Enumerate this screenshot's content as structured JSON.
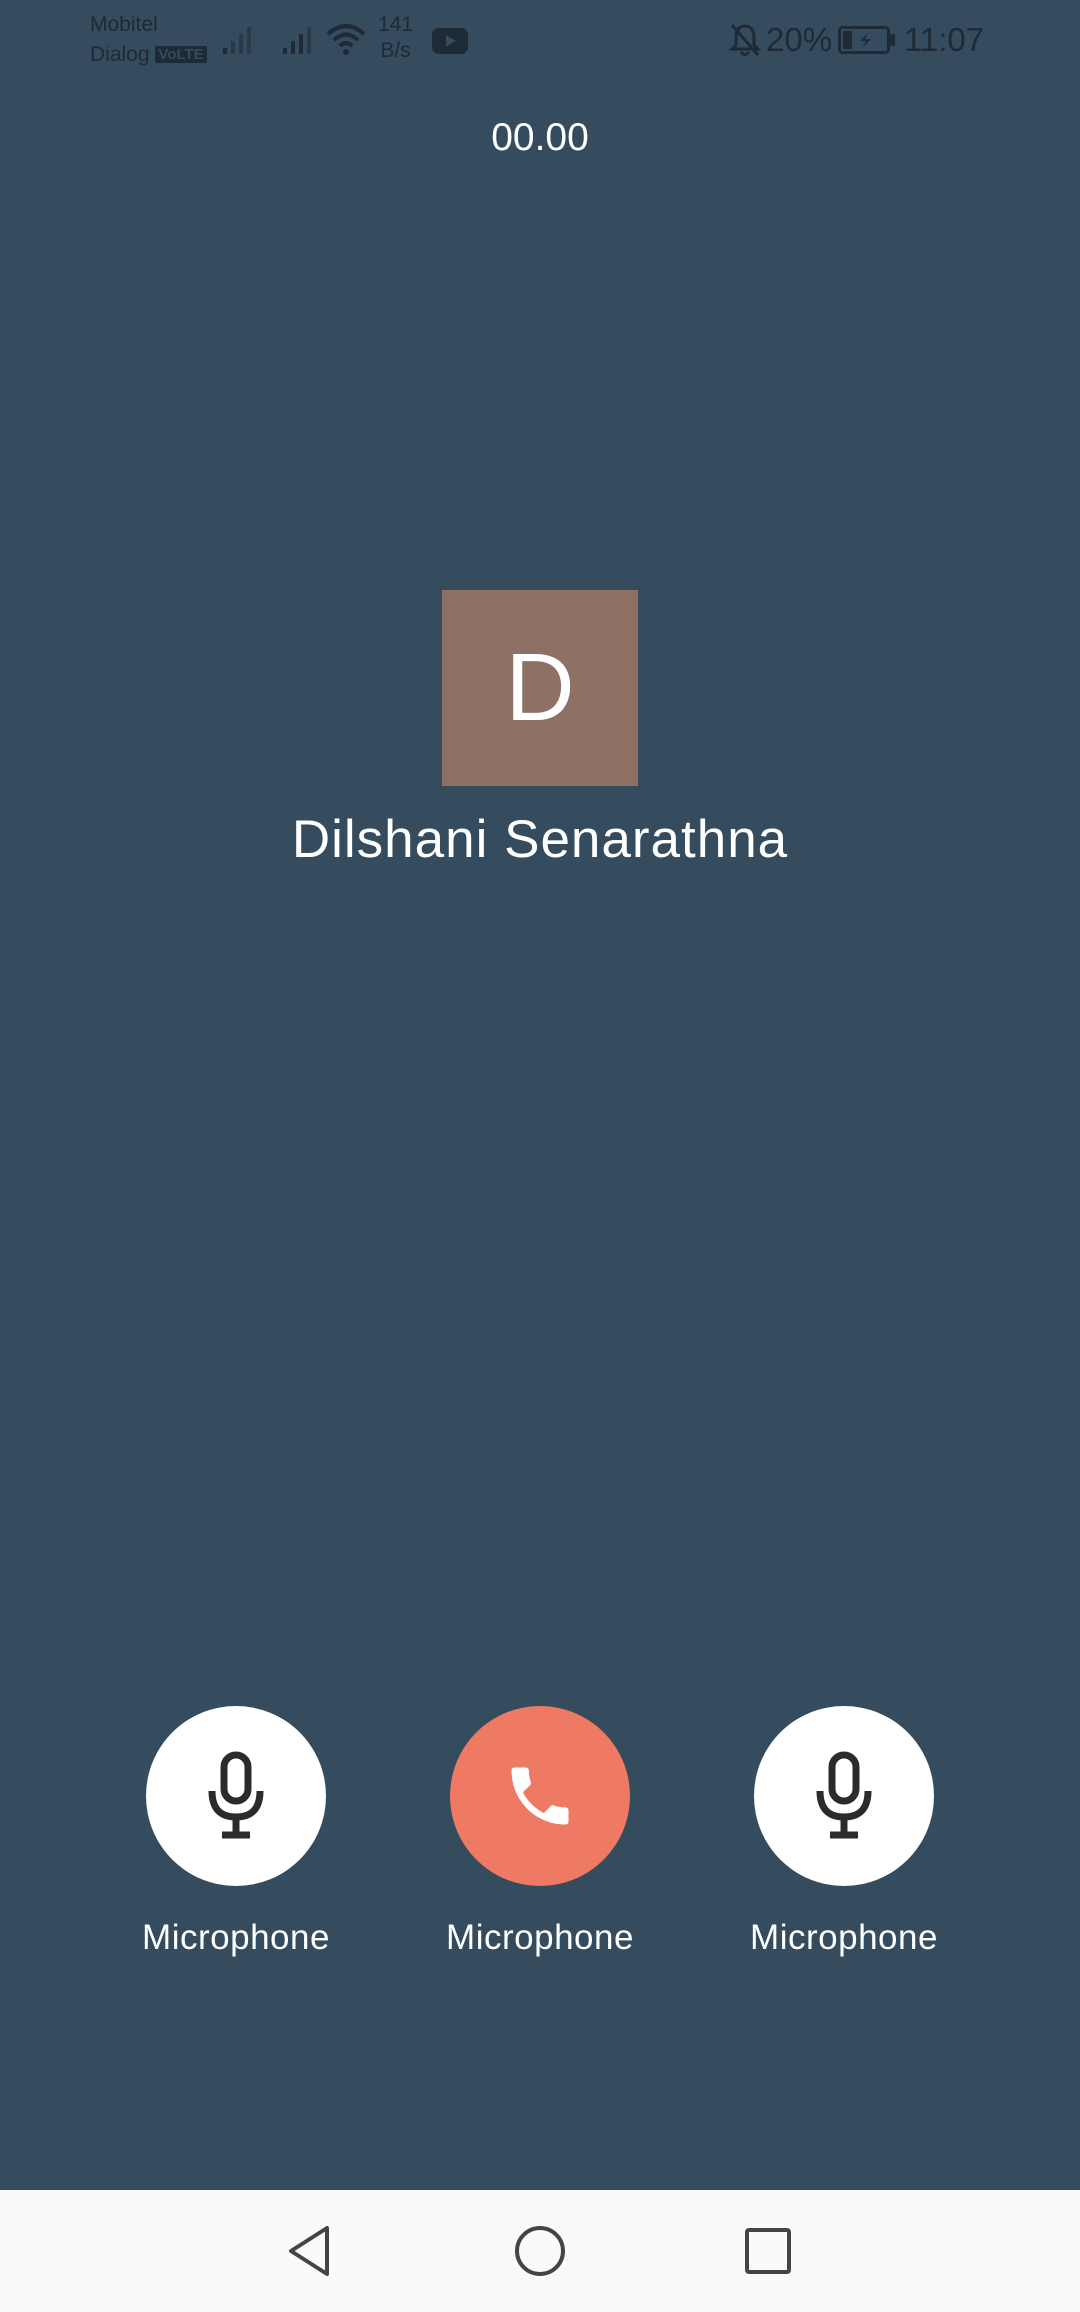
{
  "status_bar": {
    "carrier_1": "Mobitel",
    "carrier_2": "Dialog",
    "volte_badge": "VoLTE",
    "net_speed_value": "141",
    "net_speed_unit": "B/s",
    "battery_percent": "20%",
    "time": "11:07",
    "icons": [
      "signal-icon",
      "signal-icon",
      "wifi-icon",
      "youtube-icon",
      "bell-off-icon",
      "battery-charging-icon"
    ]
  },
  "call": {
    "timer": "00.00",
    "avatar_initial": "D",
    "caller_name": "Dilshani Senarathna"
  },
  "controls": [
    {
      "label": "Microphone",
      "icon": "microphone-icon",
      "color": "#ffffff"
    },
    {
      "label": "Microphone",
      "icon": "phone-icon",
      "color": "#ee7a63"
    },
    {
      "label": "Microphone",
      "icon": "microphone-icon",
      "color": "#ffffff"
    }
  ],
  "nav": {
    "icons": [
      "back-icon",
      "home-icon",
      "recents-icon"
    ]
  },
  "colors": {
    "background": "#354b5e",
    "avatar": "#8e7065",
    "end_call": "#ee7a63",
    "nav_bar": "#fafafa"
  }
}
